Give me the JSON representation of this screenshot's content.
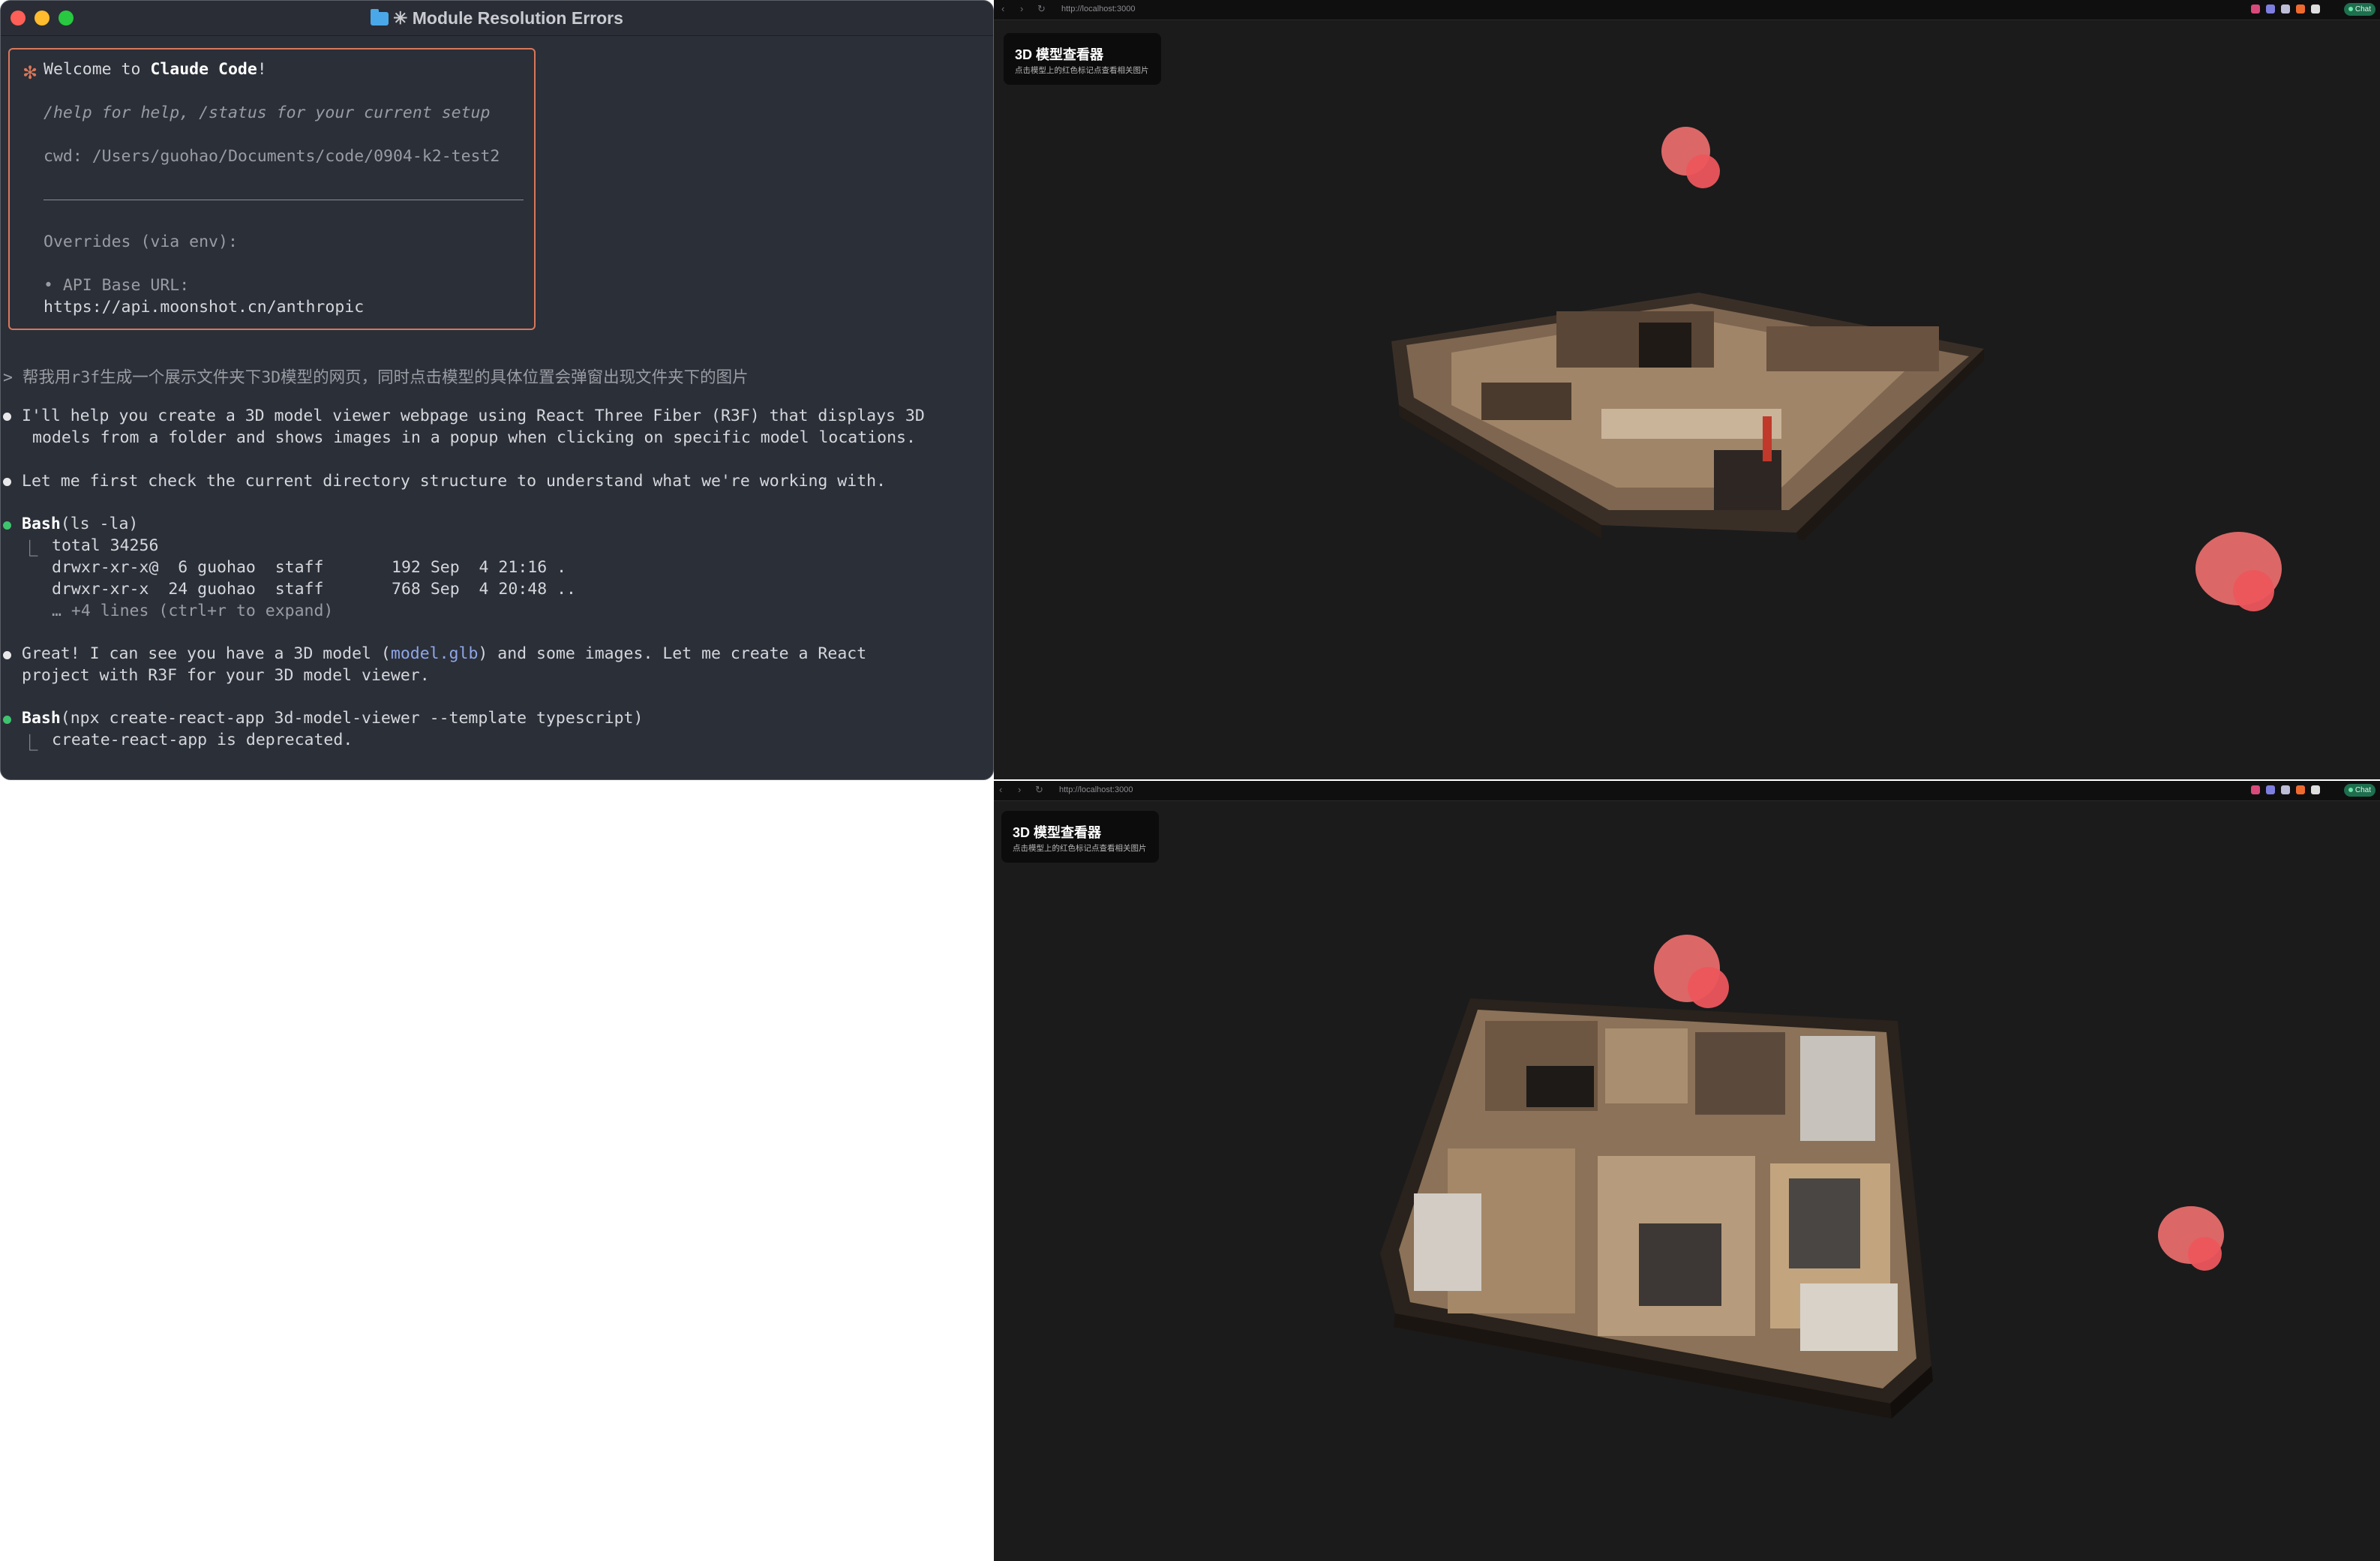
{
  "terminal": {
    "title": "✳ Module Resolution Errors",
    "welcome": {
      "star": "✻",
      "greeting_prefix": "Welcome to ",
      "greeting_bold": "Claude Code",
      "greeting_suffix": "!",
      "help": "/help for help, /status for your current setup",
      "cwd": "cwd: /Users/guohao/Documents/code/0904-k2-test2",
      "overrides": "Overrides (via env):",
      "api_label": "• API Base URL:",
      "api_url": "https://api.moonshot.cn/anthropic"
    },
    "prompt": "> 帮我用r3f生成一个展示文件夹下3D模型的网页，同时点击模型的具体位置会弹窗出现文件夹下的图片",
    "msg1_line1": "I'll help you create a 3D model viewer webpage using React Three Fiber (R3F) that displays 3D",
    "msg1_line2": "models from a folder and shows images in a popup when clicking on specific model locations.",
    "msg2": "Let me first check the current directory structure to understand what we're working with.",
    "bash1": {
      "tool": "Bash",
      "args": "(ls -la)",
      "corner": "⎿",
      "out1": "total 34256",
      "out2": "drwxr-xr-x@  6 guohao  staff       192 Sep  4 21:16 .",
      "out3": "drwxr-xr-x  24 guohao  staff       768 Sep  4 20:48 ..",
      "out4": "… +4 lines (ctrl+r to expand)"
    },
    "msg3_prefix": "Great! I can see you have a 3D model (",
    "msg3_link": "model.glb",
    "msg3_suffix": ") and some images. Let me create a React",
    "msg3_line2": "project with R3F for your 3D model viewer.",
    "bash2": {
      "tool": "Bash",
      "args": "(npx create-react-app 3d-model-viewer --template typescript)",
      "corner": "⎿",
      "out1": "create-react-app is deprecated."
    }
  },
  "browsers": [
    {
      "url": "http://localhost:3000",
      "chat": "Chat",
      "panel_title": "3D 模型查看器",
      "panel_subtitle": "点击模型上的红色标记点查看相关图片"
    },
    {
      "url": "http://localhost:3000",
      "chat": "Chat",
      "panel_title": "3D 模型查看器",
      "panel_subtitle": "点击模型上的红色标记点查看相关图片"
    }
  ],
  "colors": {
    "terminal_bg": "#2b2f38",
    "accent_orange": "#d9775a",
    "success_green": "#3ec46d",
    "viewer_bg": "#1b1b1b",
    "marker_red": "#f27070"
  }
}
